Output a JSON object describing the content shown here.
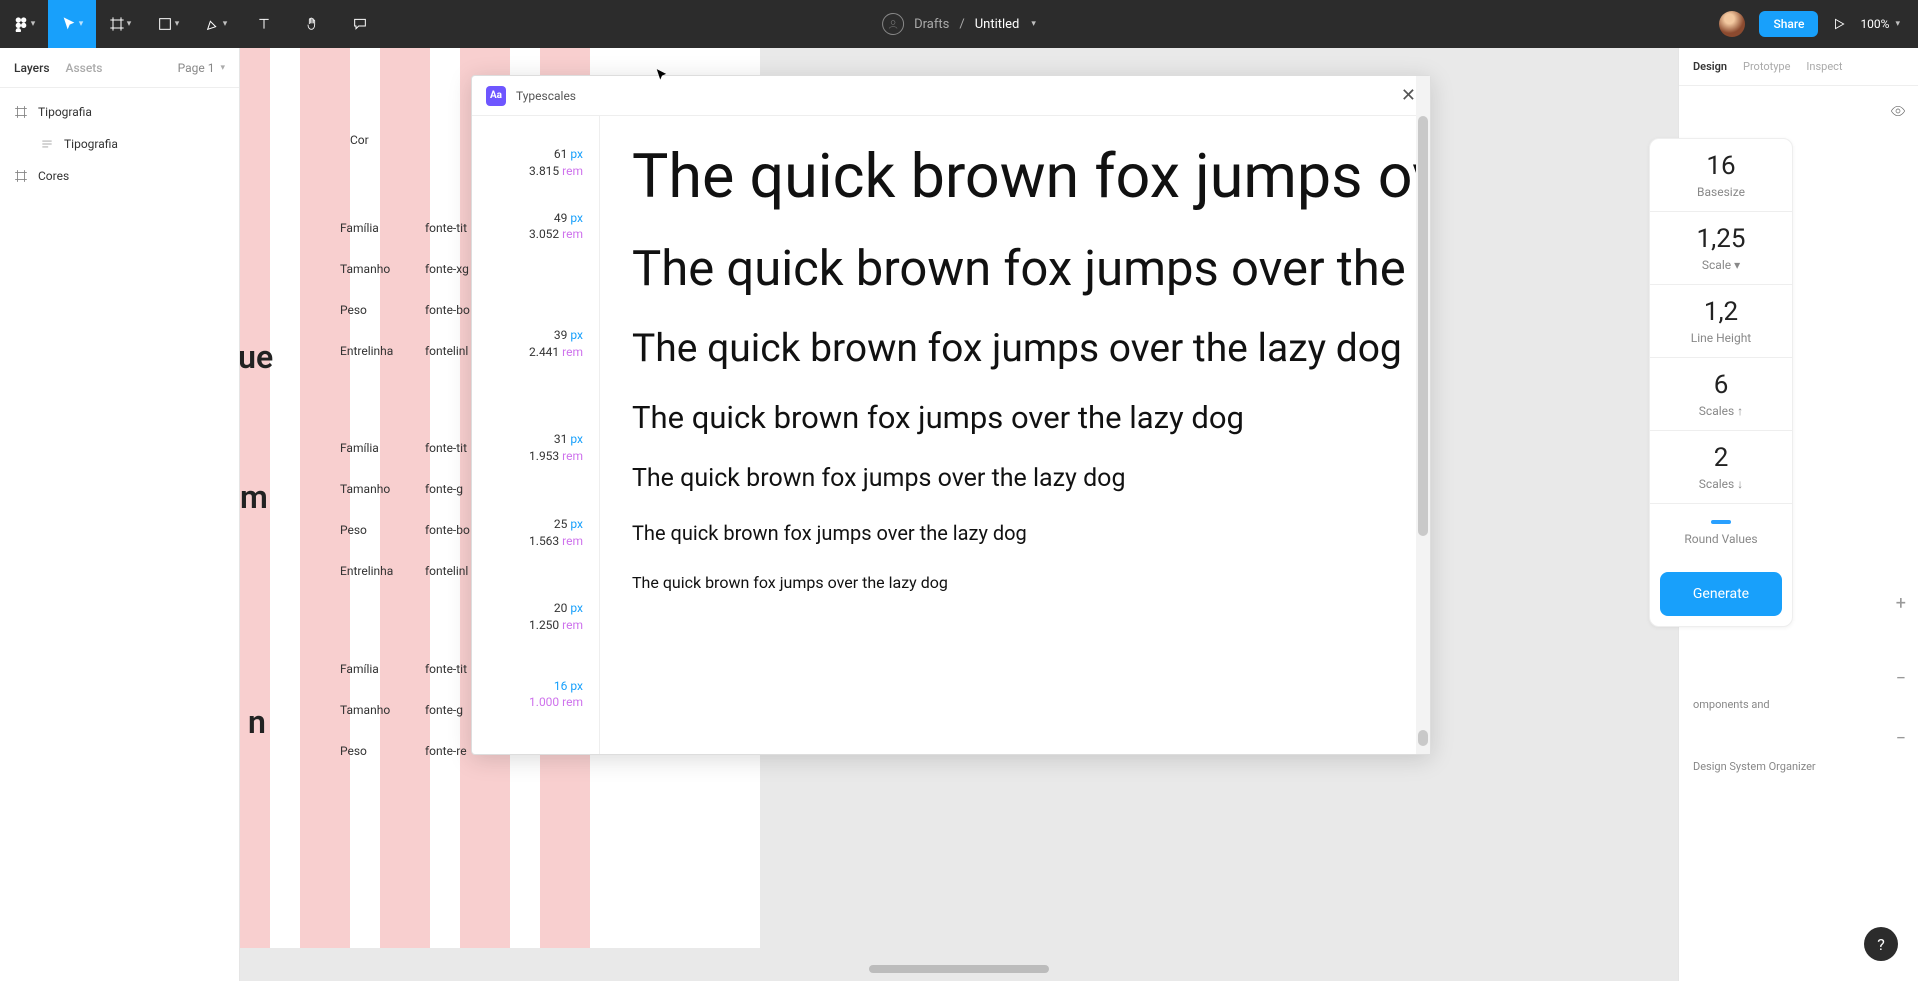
{
  "toolbar": {
    "drafts_label": "Drafts",
    "separator": "/",
    "file_name": "Untitled",
    "share_label": "Share",
    "zoom": "100%"
  },
  "left_panel": {
    "tab_layers": "Layers",
    "tab_assets": "Assets",
    "page_label": "Page 1",
    "items": [
      {
        "label": "Tipografia"
      },
      {
        "label": "Tipografia"
      },
      {
        "label": "Cores"
      }
    ]
  },
  "canvas": {
    "big1": "que",
    "big2": "m",
    "big3": "n",
    "label_cor": "Cor",
    "rows": [
      {
        "k": "Família",
        "v": "fonte-tit"
      },
      {
        "k": "Tamanho",
        "v": "fonte-xg"
      },
      {
        "k": "Peso",
        "v": "fonte-bo"
      },
      {
        "k": "Entrelinha",
        "v": "fontelinl"
      },
      {
        "k": "Família",
        "v": "fonte-tit"
      },
      {
        "k": "Tamanho",
        "v": "fonte-g"
      },
      {
        "k": "Peso",
        "v": "fonte-bo"
      },
      {
        "k": "Entrelinha",
        "v": "fontelinl"
      },
      {
        "k": "Família",
        "v": "fonte-tit"
      },
      {
        "k": "Tamanho",
        "v": "fonte-g"
      },
      {
        "k": "Peso",
        "v": "fonte-re"
      }
    ]
  },
  "right_panel": {
    "tab_design": "Design",
    "tab_prototype": "Prototype",
    "tab_inspect": "Inspect",
    "components_label": "omponents and",
    "dso_label": "Design System Organizer"
  },
  "plugin": {
    "title": "Typescales",
    "sample_text": "The quick brown fox jumps over the lazy dog",
    "px_unit": "px",
    "rem_unit": "rem",
    "scales": [
      {
        "px": "61",
        "rem": "3.815",
        "size": 61
      },
      {
        "px": "49",
        "rem": "3.052",
        "size": 49
      },
      {
        "px": "39",
        "rem": "2.441",
        "size": 39
      },
      {
        "px": "31",
        "rem": "1.953",
        "size": 31
      },
      {
        "px": "25",
        "rem": "1.563",
        "size": 25
      },
      {
        "px": "20",
        "rem": "1.250",
        "size": 20
      },
      {
        "px": "16",
        "rem": "1.000",
        "size": 16,
        "active": true
      }
    ],
    "settings": {
      "basesize_val": "16",
      "basesize_lab": "Basesize",
      "scale_val": "1,25",
      "scale_lab": "Scale ▾",
      "lineheight_val": "1,2",
      "lineheight_lab": "Line Height",
      "scalesup_val": "6",
      "scalesup_lab": "Scales ↑",
      "scalesdown_val": "2",
      "scalesdown_lab": "Scales ↓",
      "round_lab": "Round Values",
      "generate_label": "Generate"
    }
  }
}
